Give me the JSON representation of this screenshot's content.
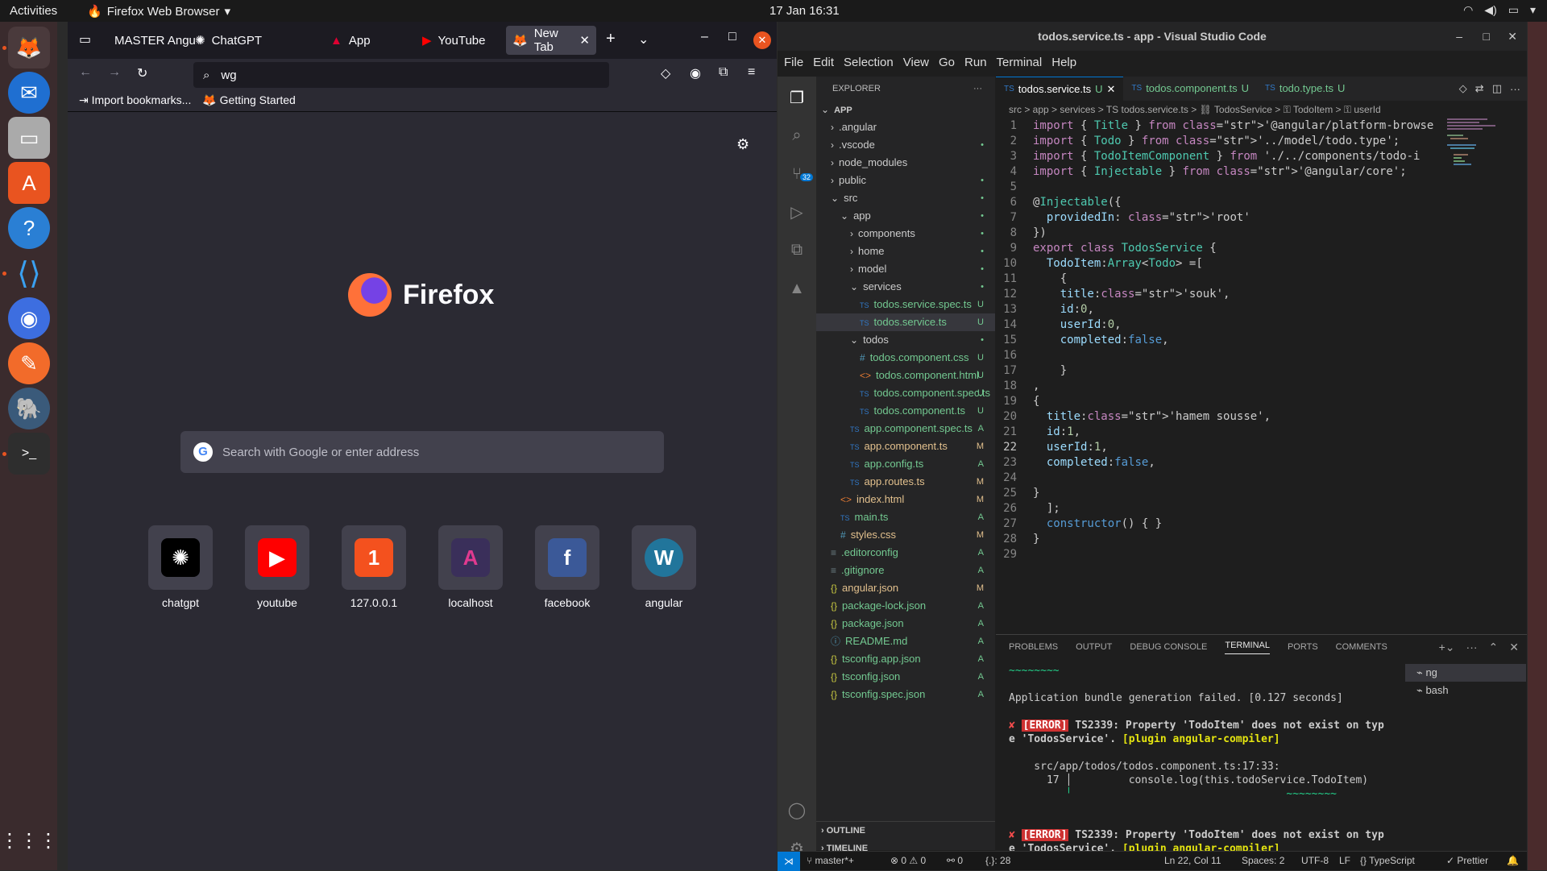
{
  "topbar": {
    "activities": "Activities",
    "app": "Firefox Web Browser",
    "clock": "17 Jan  16:31"
  },
  "firefox": {
    "tabs": [
      {
        "label": "MASTER Angu",
        "icon": "tab-icon"
      },
      {
        "label": "ChatGPT",
        "icon": "chatgpt-icon"
      },
      {
        "label": "App",
        "icon": "angular-icon"
      },
      {
        "label": "YouTube",
        "icon": "youtube-icon"
      },
      {
        "label": "New Tab",
        "icon": "firefox-icon",
        "active": true
      }
    ],
    "url": "wg",
    "bookmarks": [
      "Import bookmarks...",
      "Getting Started"
    ],
    "brand": "Firefox",
    "search_placeholder": "Search with Google or enter address",
    "tiles": [
      {
        "label": "chatgpt",
        "color": "#000000",
        "glyph": "✺"
      },
      {
        "label": "youtube",
        "color": "#ff0000",
        "glyph": "▶"
      },
      {
        "label": "127.0.0.1",
        "color": "#f4511e",
        "glyph": "1"
      },
      {
        "label": "localhost",
        "color": "#3a2f5a",
        "glyph": "A"
      },
      {
        "label": "facebook",
        "color": "#3b5998",
        "glyph": "f"
      },
      {
        "label": "angular",
        "color": "#21759b",
        "glyph": "W"
      }
    ]
  },
  "vscode": {
    "title": "todos.service.ts - app - Visual Studio Code",
    "menu": [
      "File",
      "Edit",
      "Selection",
      "View",
      "Go",
      "Run",
      "Terminal",
      "Help"
    ],
    "explorer_title": "EXPLORER",
    "tree": [
      {
        "name": "APP",
        "indent": 0,
        "kind": "root"
      },
      {
        "name": ".angular",
        "indent": 1,
        "kind": "folder"
      },
      {
        "name": ".vscode",
        "indent": 1,
        "kind": "folder",
        "badge": "•"
      },
      {
        "name": "node_modules",
        "indent": 1,
        "kind": "folder"
      },
      {
        "name": "public",
        "indent": 1,
        "kind": "folder",
        "badge": "•"
      },
      {
        "name": "src",
        "indent": 1,
        "kind": "open",
        "badge": "•"
      },
      {
        "name": "app",
        "indent": 2,
        "kind": "open",
        "badge": "•"
      },
      {
        "name": "components",
        "indent": 3,
        "kind": "folder",
        "badge": "•"
      },
      {
        "name": "home",
        "indent": 3,
        "kind": "folder",
        "badge": "•"
      },
      {
        "name": "model",
        "indent": 3,
        "kind": "folder",
        "badge": "•"
      },
      {
        "name": "services",
        "indent": 3,
        "kind": "open",
        "badge": "•"
      },
      {
        "name": "todos.service.spec.ts",
        "indent": 4,
        "kind": "ts",
        "badge": "U"
      },
      {
        "name": "todos.service.ts",
        "indent": 4,
        "kind": "ts",
        "badge": "U",
        "selected": true
      },
      {
        "name": "todos",
        "indent": 3,
        "kind": "open",
        "badge": "•"
      },
      {
        "name": "todos.component.css",
        "indent": 4,
        "kind": "css",
        "badge": "U"
      },
      {
        "name": "todos.component.html",
        "indent": 4,
        "kind": "html",
        "badge": "U"
      },
      {
        "name": "todos.component.spec.ts",
        "indent": 4,
        "kind": "ts",
        "badge": "U"
      },
      {
        "name": "todos.component.ts",
        "indent": 4,
        "kind": "ts",
        "badge": "U"
      },
      {
        "name": "app.component.spec.ts",
        "indent": 3,
        "kind": "ts",
        "badge": "A"
      },
      {
        "name": "app.component.ts",
        "indent": 3,
        "kind": "ts",
        "badge": "M"
      },
      {
        "name": "app.config.ts",
        "indent": 3,
        "kind": "ts",
        "badge": "A"
      },
      {
        "name": "app.routes.ts",
        "indent": 3,
        "kind": "ts",
        "badge": "M"
      },
      {
        "name": "index.html",
        "indent": 2,
        "kind": "html",
        "badge": "M"
      },
      {
        "name": "main.ts",
        "indent": 2,
        "kind": "ts",
        "badge": "A"
      },
      {
        "name": "styles.css",
        "indent": 2,
        "kind": "css",
        "badge": "M"
      },
      {
        "name": ".editorconfig",
        "indent": 1,
        "kind": "file",
        "badge": "A"
      },
      {
        "name": ".gitignore",
        "indent": 1,
        "kind": "file",
        "badge": "A"
      },
      {
        "name": "angular.json",
        "indent": 1,
        "kind": "json",
        "badge": "M"
      },
      {
        "name": "package-lock.json",
        "indent": 1,
        "kind": "json",
        "badge": "A"
      },
      {
        "name": "package.json",
        "indent": 1,
        "kind": "json",
        "badge": "A"
      },
      {
        "name": "README.md",
        "indent": 1,
        "kind": "md",
        "badge": "A"
      },
      {
        "name": "tsconfig.app.json",
        "indent": 1,
        "kind": "json",
        "badge": "A"
      },
      {
        "name": "tsconfig.json",
        "indent": 1,
        "kind": "json",
        "badge": "A"
      },
      {
        "name": "tsconfig.spec.json",
        "indent": 1,
        "kind": "json",
        "badge": "A"
      }
    ],
    "outline": "OUTLINE",
    "timeline": "TIMELINE",
    "editor_tabs": [
      {
        "label": "todos.service.ts",
        "badge": "U",
        "active": true
      },
      {
        "label": "todos.component.ts",
        "badge": "U"
      },
      {
        "label": "todo.type.ts",
        "badge": "U"
      }
    ],
    "breadcrumb": "src > app > services > TS todos.service.ts > ⛓ TodosService > ⚿ TodoItem > ⚿ userId",
    "code": [
      "import { Title } from '@angular/platform-browser';",
      "import { Todo } from '../model/todo.type';",
      "import { TodoItemComponent } from './../components/todo-i",
      "import { Injectable } from '@angular/core';",
      "",
      "@Injectable({",
      "  providedIn: 'root'",
      "})",
      "export class TodosService {",
      "  TodoItem:Array<Todo> =[",
      "    {",
      "    title:'souk',",
      "    id:0,",
      "    userId:0,",
      "    completed:false,",
      "",
      "    }",
      ",",
      "{",
      "  title:'hamem sousse',",
      "  id:1,",
      "  userId:1,",
      "  completed:false,",
      "",
      "}",
      "  ];",
      "  constructor() { }",
      "}",
      ""
    ],
    "current_line": 22,
    "panel_tabs": [
      "PROBLEMS",
      "OUTPUT",
      "DEBUG CONSOLE",
      "TERMINAL",
      "PORTS",
      "COMMENTS"
    ],
    "terminal_lines": [
      "~~~~~~~~",
      "",
      "Application bundle generation failed. [0.127 seconds]",
      "",
      "✘ [ERROR] TS2339: Property 'TodoItem' does not exist on typ",
      "e 'TodosService'. [plugin angular-compiler]",
      "",
      "    src/app/todos/todos.component.ts:17:33:",
      "      17 │         console.log(this.todoService.TodoItem)",
      "         ╵                                  ~~~~~~~~",
      "",
      "",
      "✘ [ERROR] TS2339: Property 'TodoItem' does not exist on typ",
      "e 'TodosService'. [plugin angular-compiler]"
    ],
    "terminals": [
      "ng",
      "bash"
    ],
    "status": {
      "branch": "master*+",
      "errors": "⊗ 0 ⚠ 0",
      "ports": "⚯ 0",
      "lines": "{.}: 28",
      "position": "Ln 22, Col 11",
      "spaces": "Spaces: 2",
      "encoding": "UTF-8",
      "eol": "LF",
      "lang": "TypeScript",
      "prettier": "✓ Prettier"
    },
    "scm_badge": "32"
  }
}
